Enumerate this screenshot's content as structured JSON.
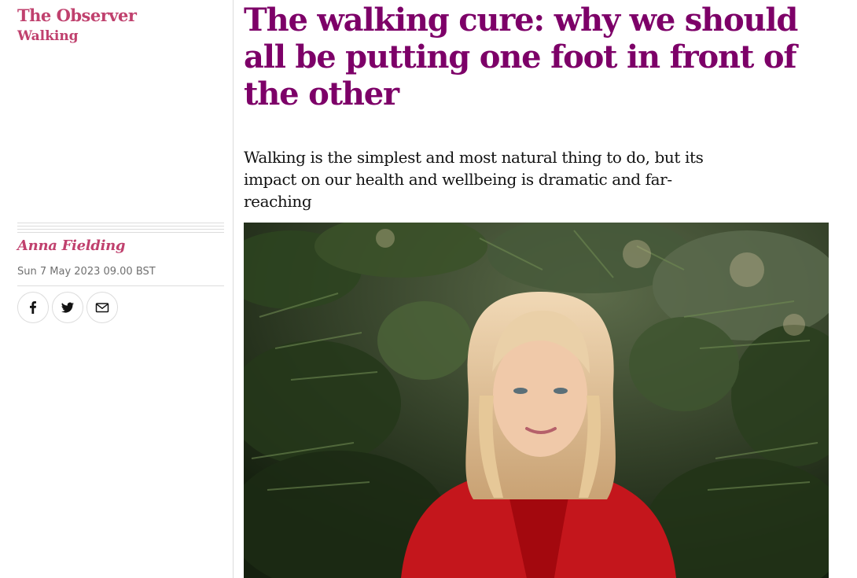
{
  "section": {
    "kicker": "The Observer",
    "tag": "Walking"
  },
  "article": {
    "headline": "The walking cure: why we should all be putting one foot in front of the other",
    "standfirst": "Walking is the simplest and most natural thing to do, but its impact on our health and wellbeing is dramatic and far-reaching",
    "byline": "Anna Fielding",
    "dateline": "Sun 7 May 2023 09.00 BST"
  },
  "share": {
    "icons": [
      "facebook-icon",
      "twitter-icon",
      "email-icon"
    ]
  },
  "hero_image": {
    "subject": "woman-with-blonde-hair-in-red-coat-in-front-of-green-foliage"
  },
  "colors": {
    "headline": "#7d0068",
    "section": "#c0416e",
    "byline": "#c0416e",
    "meta": "#707070",
    "rule": "#dcdcdc",
    "body_text": "#121212"
  }
}
